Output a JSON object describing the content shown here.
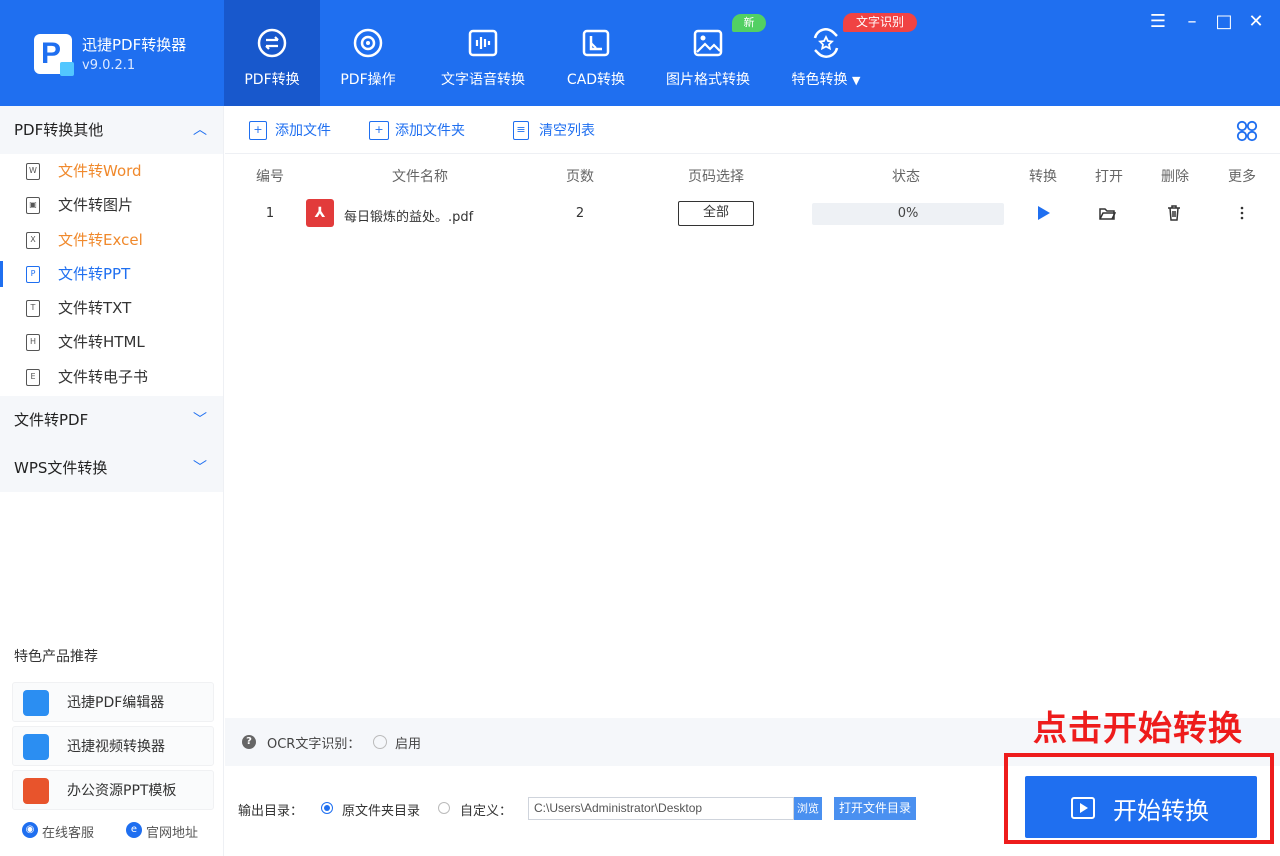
{
  "app": {
    "name": "迅捷PDF转换器",
    "version": "v9.0.2.1",
    "brand_color": "#1f6ff0"
  },
  "nav": {
    "tabs": [
      {
        "label": "PDF转换",
        "icon": "pdf-convert-icon",
        "active": true
      },
      {
        "label": "PDF操作",
        "icon": "pdf-operate-icon",
        "active": false
      },
      {
        "label": "文字语音转换",
        "icon": "text-voice-icon",
        "active": false
      },
      {
        "label": "CAD转换",
        "icon": "cad-icon",
        "active": false
      },
      {
        "label": "图片格式转换",
        "icon": "image-icon",
        "active": false,
        "badge": "新"
      },
      {
        "label": "特色转换",
        "icon": "special-icon",
        "active": false,
        "badge": "文字识别",
        "dropdown": true
      }
    ]
  },
  "window_controls": {
    "menu": "☰",
    "minimize": "–",
    "maximize": "□",
    "close": "✕"
  },
  "sidebar": {
    "sections": [
      {
        "label": "PDF转换其他",
        "expanded": true
      },
      {
        "label": "文件转PDF",
        "expanded": false
      },
      {
        "label": "WPS文件转换",
        "expanded": false
      }
    ],
    "items": [
      {
        "label": "文件转Word",
        "icon_char": "W",
        "color": "orange"
      },
      {
        "label": "文件转图片",
        "icon_char": "▣",
        "color": "normal"
      },
      {
        "label": "文件转Excel",
        "icon_char": "X",
        "color": "orange"
      },
      {
        "label": "文件转PPT",
        "icon_char": "P",
        "color": "selected"
      },
      {
        "label": "文件转TXT",
        "icon_char": "T",
        "color": "normal"
      },
      {
        "label": "文件转HTML",
        "icon_char": "H",
        "color": "normal"
      },
      {
        "label": "文件转电子书",
        "icon_char": "E",
        "color": "normal"
      }
    ],
    "recommend_title": "特色产品推荐",
    "recommend": [
      {
        "label": "迅捷PDF编辑器",
        "icon": "pdf-editor-icon",
        "color": "#2b8ef2"
      },
      {
        "label": "迅捷视频转换器",
        "icon": "video-converter-icon",
        "color": "#2b8ef2"
      },
      {
        "label": "办公资源PPT模板",
        "icon": "ppt-template-icon",
        "color": "#e8542c"
      }
    ],
    "footer": {
      "support": "在线客服",
      "website": "官网地址"
    }
  },
  "toolbar": {
    "add_file": "添加文件",
    "add_folder": "添加文件夹",
    "clear_list": "清空列表"
  },
  "table": {
    "headers": [
      "编号",
      "文件名称",
      "页数",
      "页码选择",
      "状态",
      "转换",
      "打开",
      "删除",
      "更多"
    ],
    "rows": [
      {
        "index": "1",
        "filename": "每日锻炼的益处。.pdf",
        "pages": "2",
        "page_select": "全部",
        "progress": 0,
        "status": "0%"
      }
    ]
  },
  "ocr": {
    "label": "OCR文字识别：",
    "enable": "启用"
  },
  "output": {
    "label": "输出目录：",
    "option_source": "原文件夹目录",
    "option_custom": "自定义：",
    "path": "C:\\Users\\Administrator\\Desktop",
    "browse": "浏览",
    "open_dir": "打开文件目录"
  },
  "annotation": "点击开始转换",
  "start_button": "开始转换"
}
